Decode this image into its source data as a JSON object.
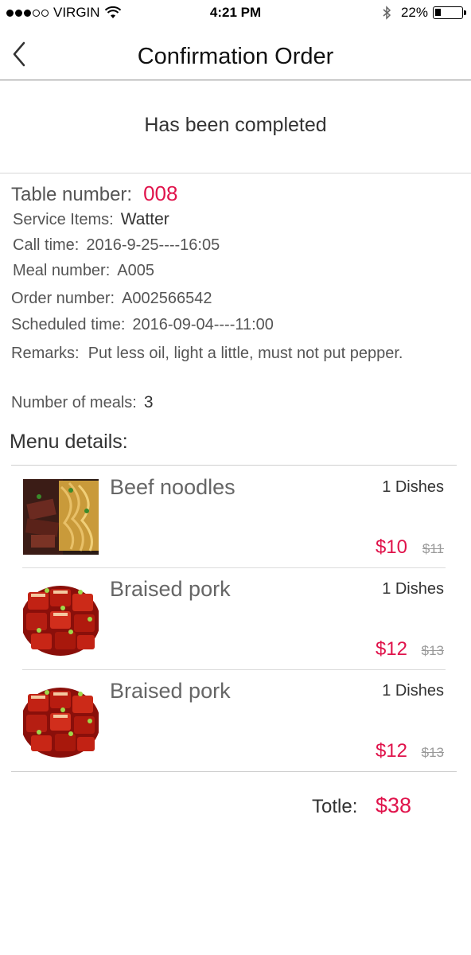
{
  "status_bar": {
    "carrier": "VIRGIN",
    "time": "4:21 PM",
    "battery_text": "22%",
    "battery_level": 0.22,
    "signal_bars_filled": 3,
    "signal_bars_total": 5
  },
  "nav": {
    "title": "Confirmation Order",
    "back_icon": "chevron-left-icon"
  },
  "order_status": "Has been completed",
  "info": {
    "table_label": "Table number:",
    "table_value": "008",
    "service_label": "Service Items:",
    "service_value": "Watter",
    "call_label": "Call time:",
    "call_value": "2016-9-25----16:05",
    "meal_label": "Meal number:",
    "meal_value": "A005",
    "order_label": "Order number:",
    "order_value": "A002566542",
    "scheduled_label": "Scheduled time:",
    "scheduled_value": "2016-09-04----11:00",
    "remarks_label": "Remarks:",
    "remarks_value": "Put less oil, light a little, must not put pepper.",
    "meals_label": "Number of meals:",
    "meals_value": "3"
  },
  "menu": {
    "title": "Menu details:",
    "items": [
      {
        "name": "Beef noodles",
        "qty": "1 Dishes",
        "price": "$10",
        "old_price": "$11",
        "image": "beef-noodles-photo"
      },
      {
        "name": "Braised pork",
        "qty": "1 Dishes",
        "price": "$12",
        "old_price": "$13",
        "image": "braised-pork-photo"
      },
      {
        "name": "Braised pork",
        "qty": "1 Dishes",
        "price": "$12",
        "old_price": "$13",
        "image": "braised-pork-photo"
      }
    ]
  },
  "total": {
    "label": "Totle:",
    "value": "$38"
  },
  "colors": {
    "accent": "#e0134b"
  }
}
